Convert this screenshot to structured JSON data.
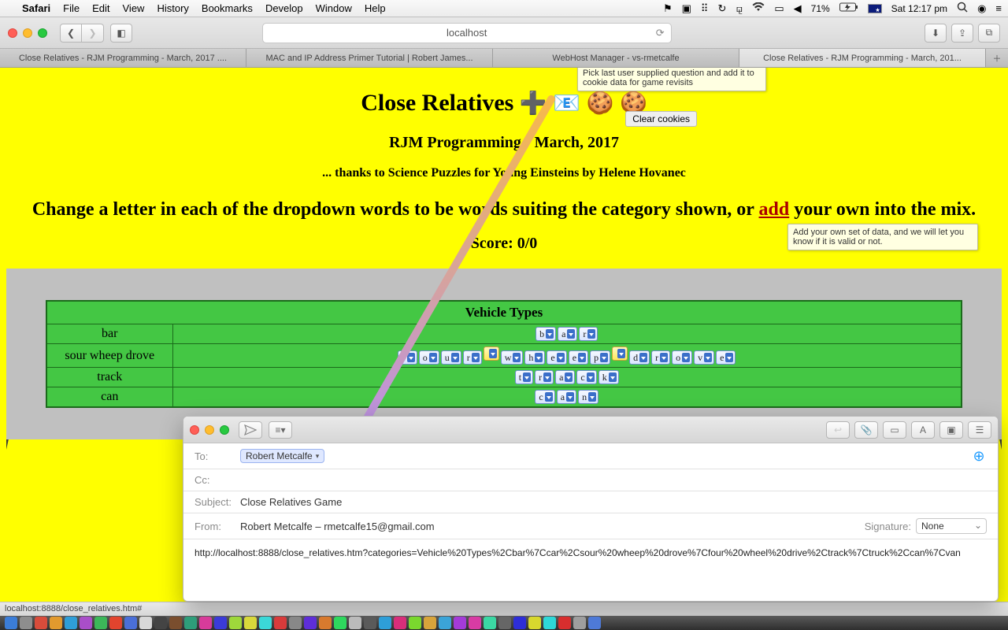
{
  "menubar": {
    "app": "Safari",
    "items": [
      "File",
      "Edit",
      "View",
      "History",
      "Bookmarks",
      "Develop",
      "Window",
      "Help"
    ],
    "battery": "71%",
    "clock": "Sat 12:17 pm"
  },
  "toolbar": {
    "url": "localhost"
  },
  "tabs": [
    "Close Relatives - RJM Programming - March, 2017 ....",
    "MAC and IP Address Primer Tutorial | Robert James...",
    "WebHost Manager - vs-rmetcalfe",
    "Close Relatives - RJM Programming - March, 201..."
  ],
  "page": {
    "title": "Close Relatives",
    "subtitle": "RJM Programming - March, 2017",
    "thanks": "... thanks to Science Puzzles for Young Einsteins by Helene Hovanec",
    "instruction_prefix": "Change a letter in each of the dropdown words to be words suiting the category shown, or ",
    "instruction_link": "add",
    "instruction_suffix": " your own into the mix.",
    "score": "Score: 0/0",
    "clear_btn": "Clear cookies",
    "tip_top": "Pick last user supplied question and add it to cookie data for game revisits",
    "tip_add": "Add your own set of data, and we will let you know if it is valid or not.",
    "category": "Vehicle Types",
    "rows": [
      {
        "word": "bar",
        "letters": [
          "b",
          "a",
          "r"
        ]
      },
      {
        "word": "sour wheep drove",
        "letters": [
          "s",
          "o",
          "u",
          "r",
          "",
          "w",
          "h",
          "e",
          "e",
          "p",
          "",
          "d",
          "r",
          "o",
          "v",
          "e"
        ],
        "yellow": [
          4,
          10
        ]
      },
      {
        "word": "track",
        "letters": [
          "t",
          "r",
          "a",
          "c",
          "k"
        ]
      },
      {
        "word": "can",
        "letters": [
          "c",
          "a",
          "n"
        ]
      }
    ]
  },
  "mail": {
    "to_label": "To:",
    "to_value": "Robert Metcalfe",
    "cc_label": "Cc:",
    "subject_label": "Subject:",
    "subject_value": "Close Relatives Game",
    "from_label": "From:",
    "from_value": "Robert Metcalfe – rmetcalfe15@gmail.com",
    "sig_label": "Signature:",
    "sig_value": "None",
    "body": "http://localhost:8888/close_relatives.htm?categories=Vehicle%20Types%2Cbar%7Ccar%2Csour%20wheep%20drove%7Cfour%20wheel%20drive%2Ctrack%7Ctruck%2Ccan%7Cvan"
  },
  "status": "localhost:8888/close_relatives.htm#",
  "dock_colors": [
    "#3b7dd8",
    "#8e8e8e",
    "#d84c3b",
    "#e29a2e",
    "#2f9ed8",
    "#a94ec9",
    "#3cb759",
    "#e2442e",
    "#4a6fd8",
    "#d8d8d8",
    "#444",
    "#7a4e2e",
    "#2e9e7a",
    "#d83b9a",
    "#3b3bd8",
    "#9ed83b",
    "#d8d83b",
    "#3bd8d8",
    "#d83b3b",
    "#888",
    "#5e2ed8",
    "#d87a2e",
    "#2ed85e",
    "#bbb",
    "#5a5a5a",
    "#2e9ed8",
    "#d82e7a",
    "#7ad82e",
    "#d8a43b",
    "#3ba4d8",
    "#a43bd8",
    "#d83ba4",
    "#3bd8a4",
    "#666",
    "#2e2ed8",
    "#d8d82e",
    "#2ed8d8",
    "#d82e2e",
    "#9e9e9e",
    "#4e7ad8"
  ]
}
